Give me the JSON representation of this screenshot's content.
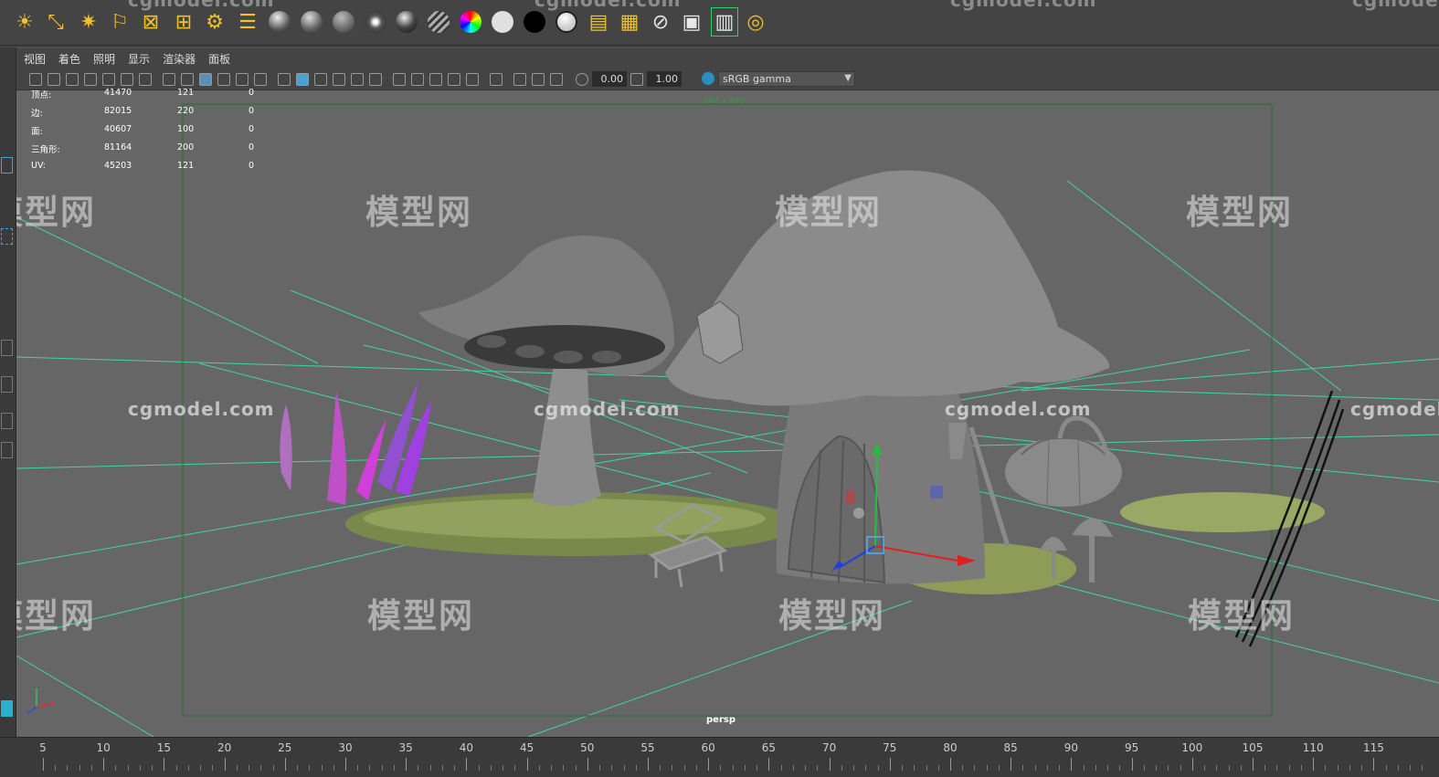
{
  "shelf": {
    "icons": [
      "sun-light-icon",
      "directional-light-icon",
      "point-light-icon",
      "spot-light-icon",
      "area-light-icon",
      "volume-light-icon",
      "render-settings-icon",
      "hypershade-icon",
      "blinn-sphere-icon",
      "phong-sphere-icon",
      "lambert-sphere-icon",
      "surface-shader-icon",
      "shiny-sphere-icon",
      "striped-sphere-icon",
      "color-wheel-icon",
      "white-circle-icon",
      "black-circle-icon",
      "white-sphere-icon",
      "image-plane-icon",
      "render-layer-icon",
      "render-pass-icon",
      "render-view-icon",
      "batch-render-icon",
      "ipr-render-icon"
    ],
    "watermarks": [
      "cgmodel.com",
      "cgmodel.com",
      "cgmodel.com",
      "cgmodel.com"
    ]
  },
  "menu": [
    "视图",
    "着色",
    "照明",
    "显示",
    "渲染器",
    "面板"
  ],
  "toolbar": {
    "exposure": "0.00",
    "gamma": "1.00",
    "color_space": "sRGB gamma"
  },
  "hud": {
    "rows": [
      {
        "label": "顶点:",
        "total": "41470",
        "selected": "121",
        "highlighted": "0"
      },
      {
        "label": "边:",
        "total": "82015",
        "selected": "220",
        "highlighted": "0"
      },
      {
        "label": "面:",
        "total": "40607",
        "selected": "100",
        "highlighted": "0"
      },
      {
        "label": "三角形:",
        "total": "81164",
        "selected": "200",
        "highlighted": "0"
      },
      {
        "label": "UV:",
        "total": "45203",
        "selected": "121",
        "highlighted": "0"
      }
    ]
  },
  "viewport": {
    "resolution_gate": "960 x 540",
    "camera": "persp",
    "watermark_cn": "模型网",
    "watermark_url": "cgmodel.com"
  },
  "timeline": {
    "ticks": [
      "5",
      "10",
      "15",
      "20",
      "25",
      "30",
      "35",
      "40",
      "45",
      "50",
      "55",
      "60",
      "65",
      "70",
      "75",
      "80",
      "85",
      "90",
      "95",
      "100",
      "105",
      "110",
      "115"
    ]
  },
  "colors": {
    "viewport_bg": "#666666",
    "grid": "#3fe0a8",
    "gate": "#2f6f3a",
    "mesh": "#8a8a8a"
  }
}
